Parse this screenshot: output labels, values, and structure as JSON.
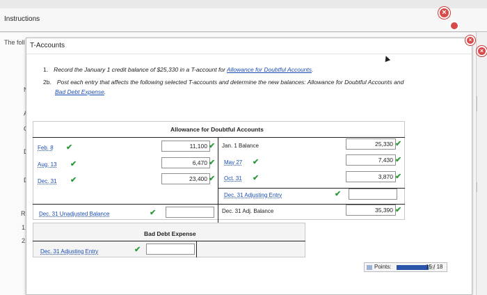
{
  "outer": {
    "title": "Instructions",
    "behind_text": "The foll",
    "left_markers": [
      "N",
      "A",
      "C",
      "D",
      "D",
      "Re",
      "1.",
      "2."
    ]
  },
  "dialog": {
    "title": "T-Accounts"
  },
  "instructions": {
    "item1_num": "1.",
    "item1_text": "Record the January 1 credit balance of $25,330 in a T-account for",
    "item1_link": "Allowance for Doubtful Accounts",
    "item1_end": ".",
    "item2_num": "2b.",
    "item2_text": "Post each entry that affects the following selected T-accounts and determine the new balances: Allowance for Doubtful Accounts and",
    "item2_link": "Bad Debt Expense",
    "item2_end": "."
  },
  "allowance": {
    "title": "Allowance for Doubtful Accounts",
    "debits": [
      {
        "label": "Feb. 8",
        "amount": "11,100"
      },
      {
        "label": "Aug. 13",
        "amount": "6,470"
      },
      {
        "label": "Dec. 31",
        "amount": "23,400"
      }
    ],
    "credits": [
      {
        "label": "Jan. 1 Balance",
        "amount": "25,330"
      },
      {
        "label": "May 27",
        "amount": "7,430"
      },
      {
        "label": "Oct. 31",
        "amount": "3,870"
      },
      {
        "label": "Dec. 31 Adjusting Entry",
        "amount": ""
      }
    ],
    "unadjusted_label": "Dec. 31 Unadjusted Balance",
    "unadjusted_amount": "",
    "adj_balance_label": "Dec. 31 Adj. Balance",
    "adj_balance_amount": "35,390"
  },
  "bad_debt": {
    "title": "Bad Debt Expense",
    "entry_label": "Dec. 31 Adjusting Entry",
    "entry_amount": ""
  },
  "points": {
    "label": "Points:",
    "score": "15 / 18",
    "fraction": 0.833
  },
  "colors": {
    "check": "#2e9a3c",
    "link": "#1a4db4",
    "close": "#d84a4a"
  }
}
